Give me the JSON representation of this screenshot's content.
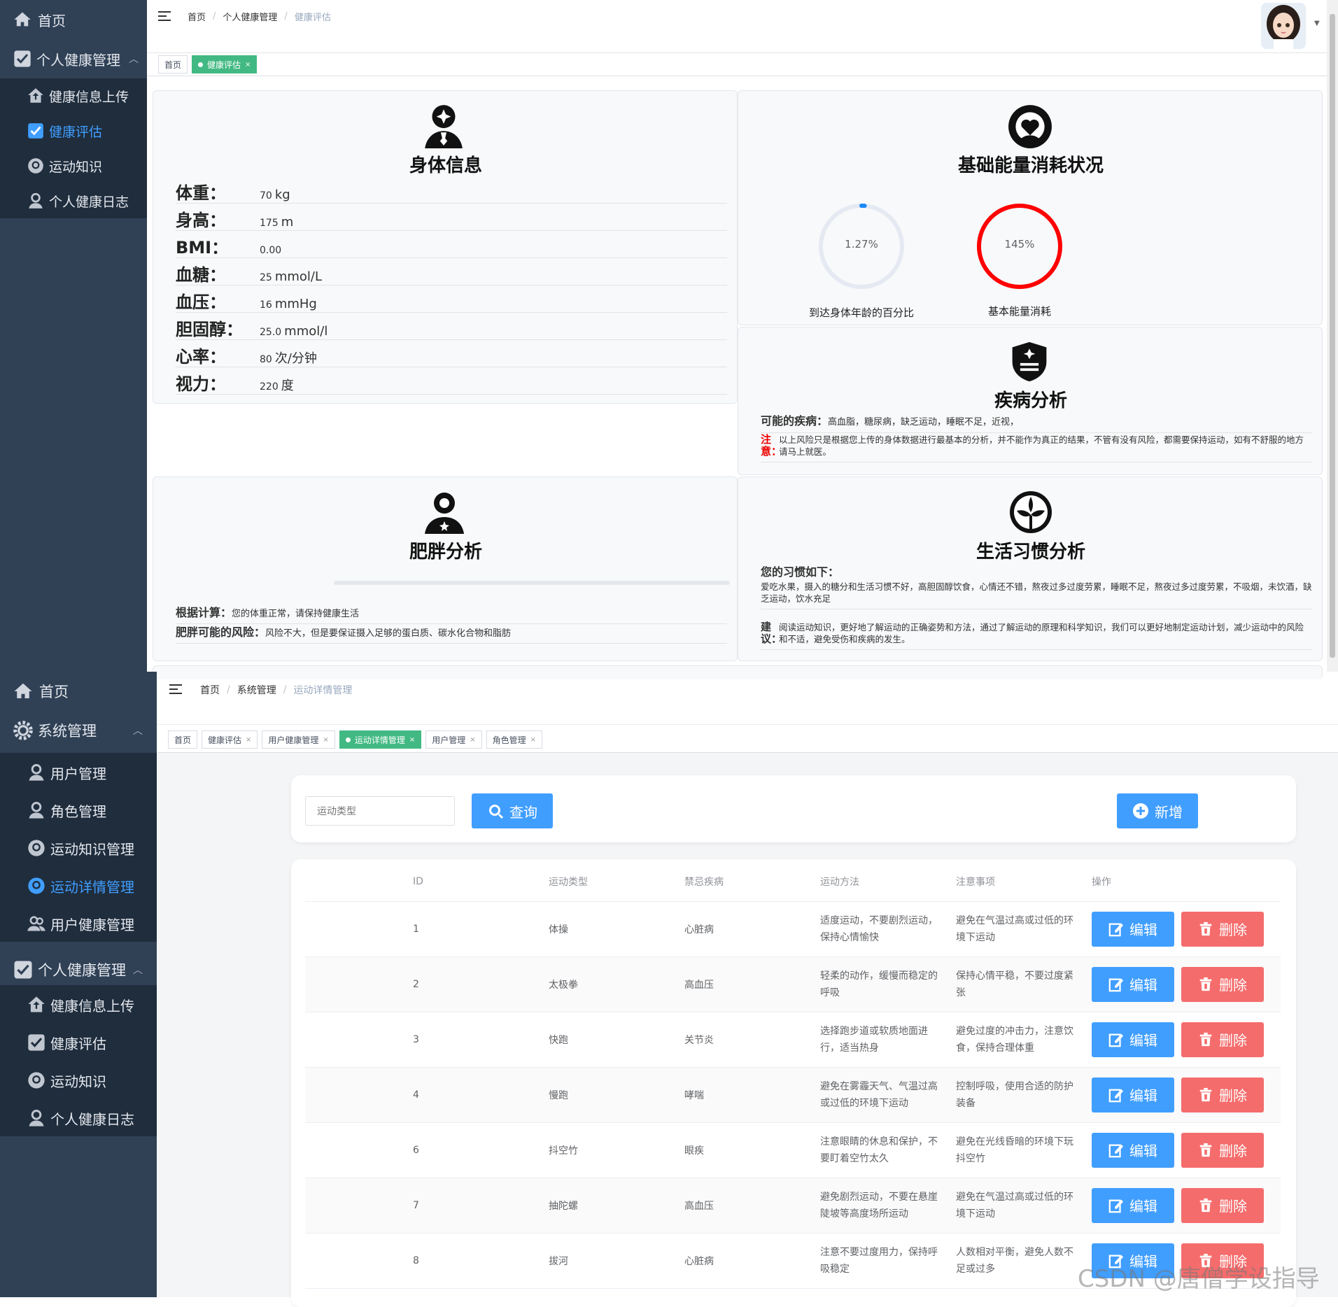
{
  "screen1": {
    "sidebar": {
      "items": [
        {
          "label": "首页",
          "icon": "home-icon"
        },
        {
          "label": "个人健康管理",
          "icon": "checkbox-icon"
        },
        {
          "label": "健康信息上传",
          "icon": "house-upload-icon"
        },
        {
          "label": "健康评估",
          "icon": "checkbox-icon",
          "active": true
        },
        {
          "label": "运动知识",
          "icon": "face-icon"
        },
        {
          "label": "个人健康日志",
          "icon": "user-icon"
        }
      ]
    },
    "breadcrumb": [
      "首页",
      "个人健康管理",
      "健康评估"
    ],
    "tags": [
      {
        "label": "首页"
      },
      {
        "label": "健康评估",
        "active": true
      }
    ],
    "body_info": {
      "title": "身体信息",
      "rows": [
        {
          "label": "体重：",
          "value": "70",
          "unit": "kg"
        },
        {
          "label": "身高：",
          "value": "175",
          "unit": "m"
        },
        {
          "label": "BMI：",
          "value": "0.00",
          "unit": ""
        },
        {
          "label": "血糖：",
          "value": "25",
          "unit": "mmol/L"
        },
        {
          "label": "血压：",
          "value": "16",
          "unit": "mmHg"
        },
        {
          "label": "胆固醇：",
          "value": "25.0",
          "unit": "mmol/l"
        },
        {
          "label": "心率：",
          "value": "80",
          "unit": "次/分钟"
        },
        {
          "label": "视力：",
          "value": "220",
          "unit": "度"
        }
      ]
    },
    "energy": {
      "title": "基础能量消耗状况",
      "ring1": {
        "text": "1.27%",
        "percent": 1.27,
        "caption": "到达身体年龄的百分比",
        "color": "#1989fa"
      },
      "ring2": {
        "text": "145%",
        "percent": 145,
        "caption": "基本能量消耗",
        "color": "#ff0000"
      }
    },
    "disease": {
      "title": "疾病分析",
      "possible_label": "可能的疾病：",
      "possible_text": "高血脂，糖尿病，缺乏运动，睡眠不足，近视，",
      "note_label": "注意：",
      "note_text": "以上风险只是根据您上传的身体数据进行最基本的分析，并不能作为真正的结果，不管有没有风险，都需要保持运动，如有不舒服的地方请马上就医。"
    },
    "obesity": {
      "title": "肥胖分析",
      "calc_label": "根据计算：",
      "calc_text": "您的体重正常，请保持健康生活",
      "risk_label": "肥胖可能的风险：",
      "risk_text": "风险不大，但是要保证摄入足够的蛋白质、碳水化合物和脂肪"
    },
    "habits": {
      "title": "生活习惯分析",
      "intro": "您的习惯如下：",
      "text": "爱吃水果，摄入的糖分和生活习惯不好，高胆固醇饮食，心情还不错，熬夜过多过度劳累，睡眠不足，熬夜过多过度劳累，不吸烟，未饮酒，缺乏运动，饮水充足",
      "advice_label": "建议：",
      "advice_text": "阅读运动知识，更好地了解运动的正确姿势和方法，通过了解运动的原理和科学知识，我们可以更好地制定运动计划，减少运动中的风险和不适，避免受伤和疾病的发生。"
    }
  },
  "screen2": {
    "sidebar": {
      "items": [
        {
          "label": "首页",
          "icon": "home-icon"
        },
        {
          "label": "系统管理",
          "icon": "gear-icon"
        },
        {
          "label": "用户管理",
          "icon": "user-icon"
        },
        {
          "label": "角色管理",
          "icon": "user-icon"
        },
        {
          "label": "运动知识管理",
          "icon": "face-icon"
        },
        {
          "label": "运动详情管理",
          "icon": "face-icon",
          "active": true
        },
        {
          "label": "用户健康管理",
          "icon": "users-icon"
        },
        {
          "label": "个人健康管理",
          "icon": "checkbox-icon"
        },
        {
          "label": "健康信息上传",
          "icon": "house-upload-icon"
        },
        {
          "label": "健康评估",
          "icon": "checkbox-icon"
        },
        {
          "label": "运动知识",
          "icon": "face-icon"
        },
        {
          "label": "个人健康日志",
          "icon": "user-icon"
        }
      ]
    },
    "breadcrumb": [
      "首页",
      "系统管理",
      "运动详情管理"
    ],
    "tags": [
      {
        "label": "首页"
      },
      {
        "label": "健康评估"
      },
      {
        "label": "用户健康管理"
      },
      {
        "label": "运动详情管理",
        "active": true
      },
      {
        "label": "用户管理"
      },
      {
        "label": "角色管理"
      }
    ],
    "search": {
      "placeholder": "运动类型",
      "query_label": "查询",
      "add_label": "新增"
    },
    "table": {
      "headers": [
        "ID",
        "运动类型",
        "禁忌疾病",
        "运动方法",
        "注意事项",
        "操作"
      ],
      "edit_label": "编辑",
      "delete_label": "删除",
      "rows": [
        {
          "id": "1",
          "type": "体操",
          "taboo": "心脏病",
          "method": "适度运动，不要剧烈运动，保持心情愉快",
          "note": "避免在气温过高或过低的环境下运动"
        },
        {
          "id": "2",
          "type": "太极拳",
          "taboo": "高血压",
          "method": "轻柔的动作，缓慢而稳定的呼吸",
          "note": "保持心情平稳，不要过度紧张"
        },
        {
          "id": "3",
          "type": "快跑",
          "taboo": "关节炎",
          "method": "选择跑步道或软质地面进行，适当热身",
          "note": "避免过度的冲击力，注意饮食，保持合理体重"
        },
        {
          "id": "4",
          "type": "慢跑",
          "taboo": "哮喘",
          "method": "避免在雾霾天气、气温过高或过低的环境下运动",
          "note": "控制呼吸，使用合适的防护装备"
        },
        {
          "id": "6",
          "type": "抖空竹",
          "taboo": "眼疾",
          "method": "注意眼睛的休息和保护，不要盯着空竹太久",
          "note": "避免在光线昏暗的环境下玩抖空竹"
        },
        {
          "id": "7",
          "type": "抽陀螺",
          "taboo": "高血压",
          "method": "避免剧烈运动，不要在悬崖陡坡等高度场所运动",
          "note": "避免在气温过高或过低的环境下运动"
        },
        {
          "id": "8",
          "type": "拔河",
          "taboo": "心脏病",
          "method": "注意不要过度用力，保持呼吸稳定",
          "note": "人数相对平衡，避免人数不足或过多"
        }
      ]
    }
  },
  "watermark": "CSDN @唐僧学设指导"
}
